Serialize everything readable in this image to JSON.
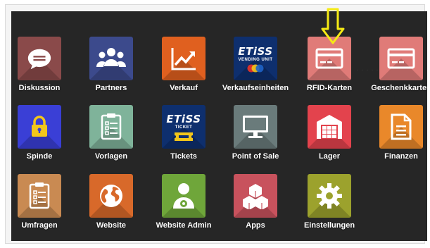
{
  "apps": [
    {
      "id": "diskussion",
      "label": "Diskussion",
      "color": "#8a4a4a",
      "icon": "chat-bubble-icon"
    },
    {
      "id": "partners",
      "label": "Partners",
      "color": "#3c4a8c",
      "icon": "users-icon"
    },
    {
      "id": "verkauf",
      "label": "Verkauf",
      "color": "#e0601f",
      "icon": "trend-chart-icon"
    },
    {
      "id": "verkaufseinheiten",
      "label": "Verkaufseinheiten",
      "color": "#0e2f6e",
      "icon": "etiss-vending-logo",
      "logo_word": "ETiSS",
      "logo_sub": "VENDING UNIT"
    },
    {
      "id": "rfid-karten",
      "label": "RFID-Karten",
      "color": "#e07b78",
      "icon": "card-icon"
    },
    {
      "id": "geschenkkarten",
      "label": "Geschenkkarten",
      "color": "#e07b78",
      "icon": "card-icon"
    },
    {
      "id": "spinde",
      "label": "Spinde",
      "color": "#3a3fd6",
      "icon": "lock-icon"
    },
    {
      "id": "vorlagen",
      "label": "Vorlagen",
      "color": "#7fb39a",
      "icon": "checklist-icon"
    },
    {
      "id": "tickets",
      "label": "Tickets",
      "color": "#0e2f6e",
      "icon": "etiss-ticket-logo",
      "logo_word": "ETiSS",
      "logo_sub": "TICKET"
    },
    {
      "id": "point-of-sale",
      "label": "Point of Sale",
      "color": "#6a7b7b",
      "icon": "monitor-icon"
    },
    {
      "id": "lager",
      "label": "Lager",
      "color": "#e3434d",
      "icon": "warehouse-icon"
    },
    {
      "id": "finanzen",
      "label": "Finanzen",
      "color": "#e9882a",
      "icon": "document-icon"
    },
    {
      "id": "umfragen",
      "label": "Umfragen",
      "color": "#c98a52",
      "icon": "clipboard-icon"
    },
    {
      "id": "website",
      "label": "Website",
      "color": "#d8692a",
      "icon": "globe-icon"
    },
    {
      "id": "website-admin",
      "label": "Website Admin",
      "color": "#6fa63a",
      "icon": "user-gear-icon"
    },
    {
      "id": "apps",
      "label": "Apps",
      "color": "#c8525d",
      "icon": "cubes-icon"
    },
    {
      "id": "einstellungen",
      "label": "Einstellungen",
      "color": "#9ca22d",
      "icon": "gear-icon"
    }
  ],
  "highlight_arrow_color": "#f5ea14"
}
